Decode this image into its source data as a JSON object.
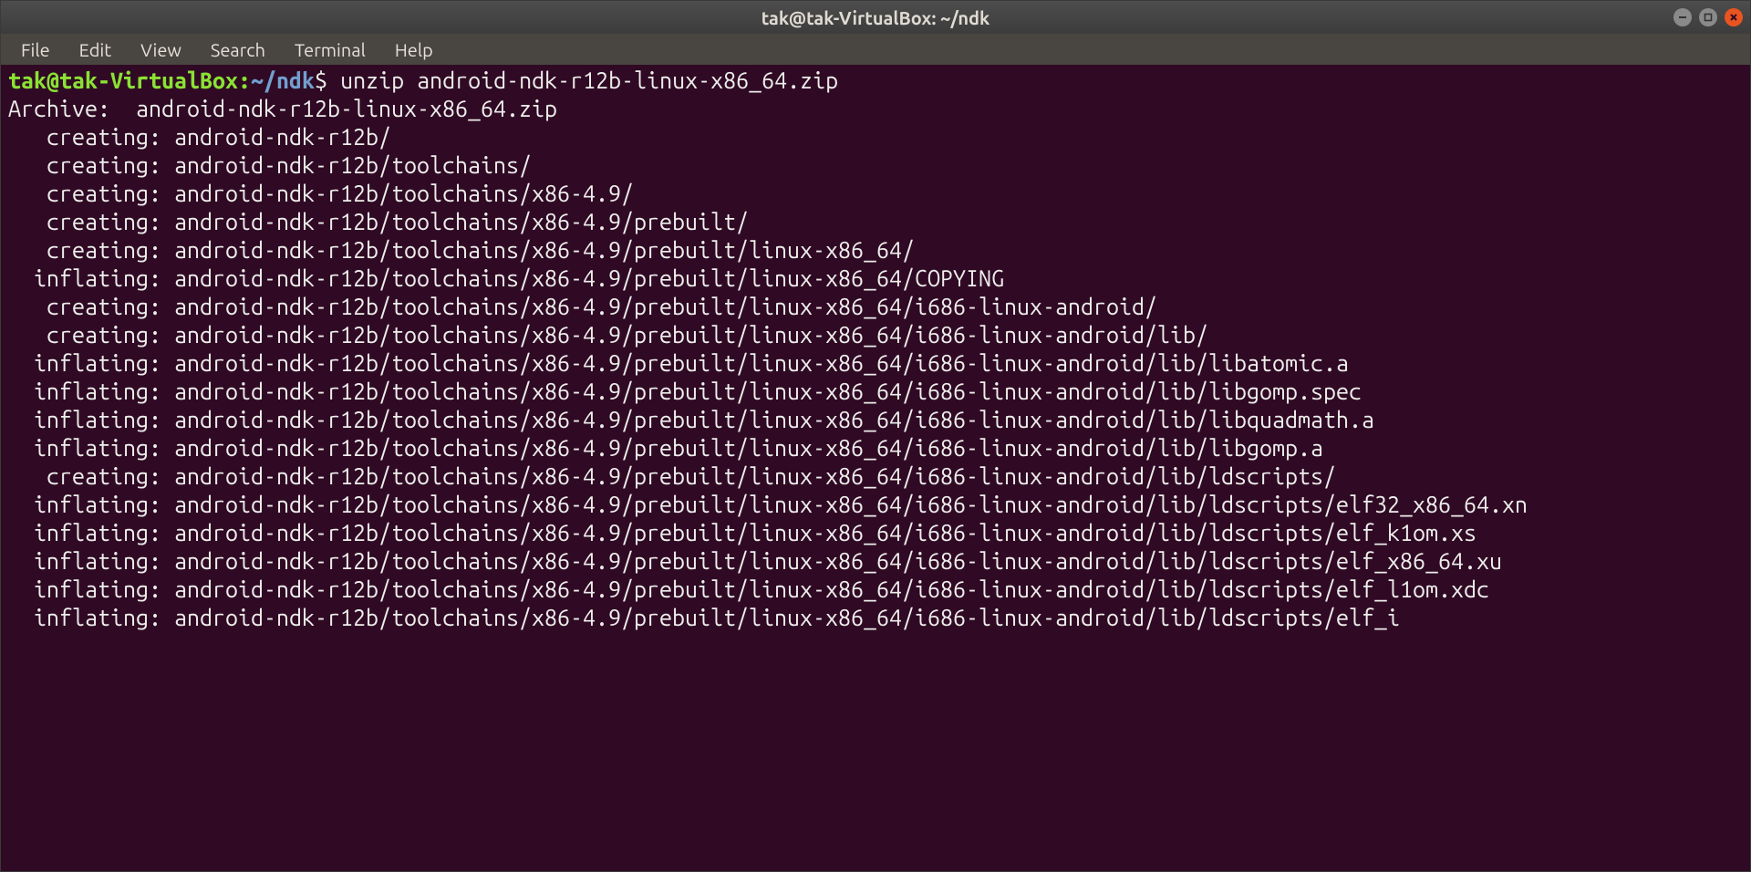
{
  "window": {
    "title": "tak@tak-VirtualBox: ~/ndk"
  },
  "menubar": {
    "items": [
      "File",
      "Edit",
      "View",
      "Search",
      "Terminal",
      "Help"
    ]
  },
  "prompt": {
    "user_host": "tak@tak-VirtualBox",
    "separator": ":",
    "path": "~/ndk",
    "symbol": "$ "
  },
  "command": "unzip android-ndk-r12b-linux-x86_64.zip",
  "output_lines": [
    "Archive:  android-ndk-r12b-linux-x86_64.zip",
    "   creating: android-ndk-r12b/",
    "   creating: android-ndk-r12b/toolchains/",
    "   creating: android-ndk-r12b/toolchains/x86-4.9/",
    "   creating: android-ndk-r12b/toolchains/x86-4.9/prebuilt/",
    "   creating: android-ndk-r12b/toolchains/x86-4.9/prebuilt/linux-x86_64/",
    "  inflating: android-ndk-r12b/toolchains/x86-4.9/prebuilt/linux-x86_64/COPYING",
    "   creating: android-ndk-r12b/toolchains/x86-4.9/prebuilt/linux-x86_64/i686-linux-android/",
    "   creating: android-ndk-r12b/toolchains/x86-4.9/prebuilt/linux-x86_64/i686-linux-android/lib/",
    "  inflating: android-ndk-r12b/toolchains/x86-4.9/prebuilt/linux-x86_64/i686-linux-android/lib/libatomic.a",
    "  inflating: android-ndk-r12b/toolchains/x86-4.9/prebuilt/linux-x86_64/i686-linux-android/lib/libgomp.spec",
    "  inflating: android-ndk-r12b/toolchains/x86-4.9/prebuilt/linux-x86_64/i686-linux-android/lib/libquadmath.a",
    "  inflating: android-ndk-r12b/toolchains/x86-4.9/prebuilt/linux-x86_64/i686-linux-android/lib/libgomp.a",
    "   creating: android-ndk-r12b/toolchains/x86-4.9/prebuilt/linux-x86_64/i686-linux-android/lib/ldscripts/",
    "  inflating: android-ndk-r12b/toolchains/x86-4.9/prebuilt/linux-x86_64/i686-linux-android/lib/ldscripts/elf32_x86_64.xn",
    "  inflating: android-ndk-r12b/toolchains/x86-4.9/prebuilt/linux-x86_64/i686-linux-android/lib/ldscripts/elf_k1om.xs",
    "  inflating: android-ndk-r12b/toolchains/x86-4.9/prebuilt/linux-x86_64/i686-linux-android/lib/ldscripts/elf_x86_64.xu",
    "  inflating: android-ndk-r12b/toolchains/x86-4.9/prebuilt/linux-x86_64/i686-linux-android/lib/ldscripts/elf_l1om.xdc",
    "  inflating: android-ndk-r12b/toolchains/x86-4.9/prebuilt/linux-x86_64/i686-linux-android/lib/ldscripts/elf_i"
  ]
}
